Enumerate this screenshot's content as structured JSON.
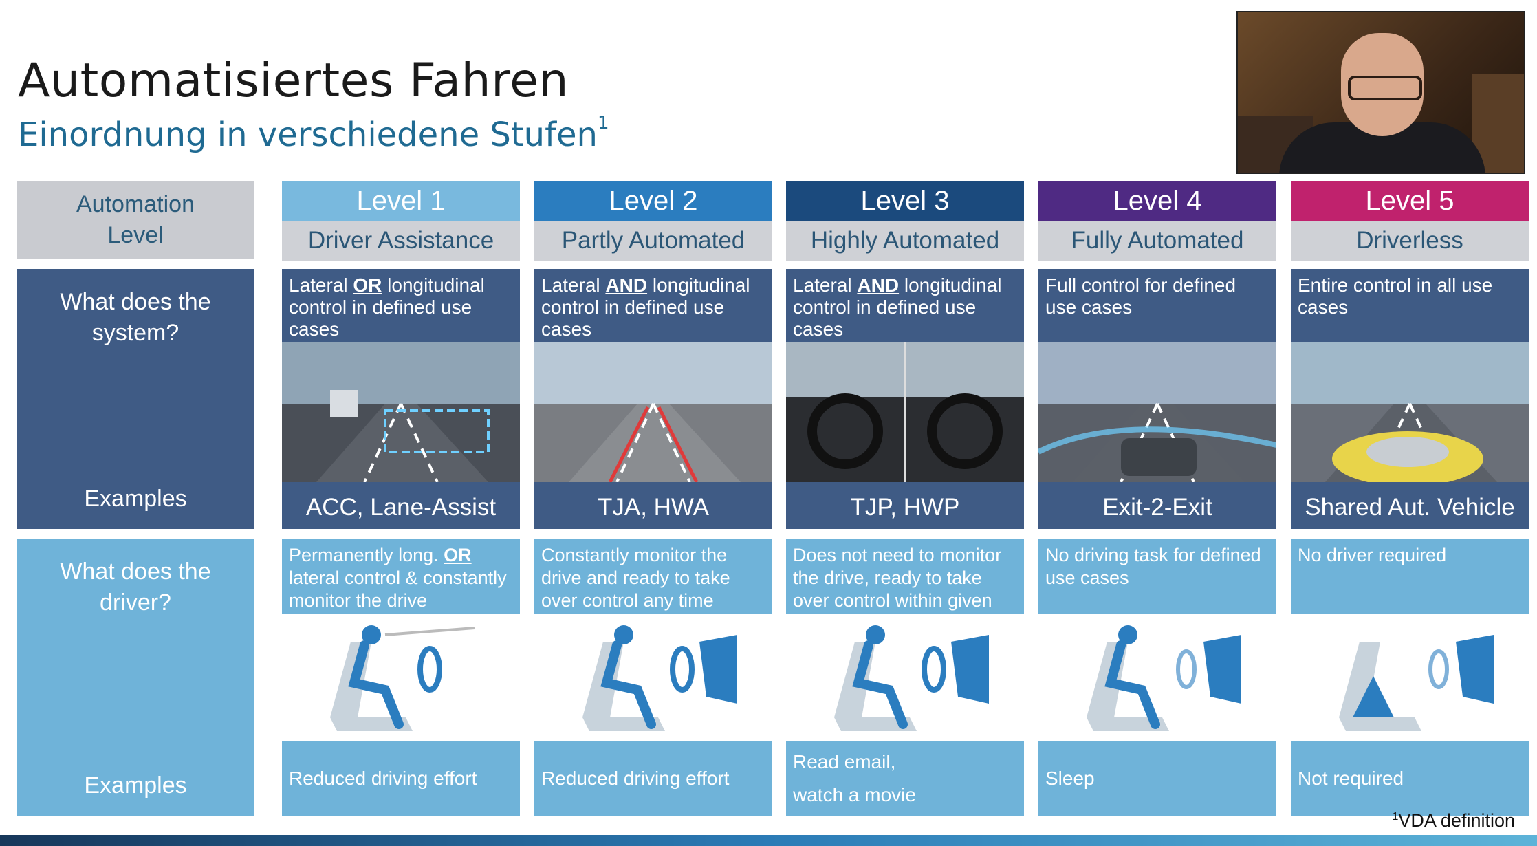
{
  "header": {
    "title": "Automatisiertes Fahren",
    "subtitle": "Einordnung in verschiedene Stufen",
    "subtitle_sup": "1"
  },
  "left": {
    "header": "Automation\nLevel",
    "system_q": "What does the\nsystem?",
    "system_ex": "Examples",
    "driver_q": "What does the\ndriver?",
    "driver_ex": "Examples"
  },
  "levels": [
    {
      "level": "Level 1",
      "name": "Driver Assistance",
      "color": "#79b9de",
      "sys_pre": "Lateral ",
      "sys_bold": "OR",
      "sys_post": " longitudinal control in defined use cases",
      "example": "ACC, Lane-Assist",
      "drv_pre": "Permanently long. ",
      "drv_bold": "OR",
      "drv_post": " lateral control & constantly monitor the drive",
      "drv_example": "Reduced driving effort"
    },
    {
      "level": "Level 2",
      "name": "Partly Automated",
      "color": "#2b7dbf",
      "sys_pre": "Lateral ",
      "sys_bold": "AND",
      "sys_post": " longitudinal control in defined use cases",
      "example": "TJA, HWA",
      "drv_pre": "Constantly monitor the drive and ready to take over control any time",
      "drv_bold": "",
      "drv_post": "",
      "drv_example": "Reduced driving effort"
    },
    {
      "level": "Level 3",
      "name": "Highly Automated",
      "color": "#1b4a7d",
      "sys_pre": "Lateral ",
      "sys_bold": "AND",
      "sys_post": " longitudinal control in defined use cases",
      "example": "TJP, HWP",
      "drv_pre": "Does not need to monitor the drive, ready to take over control  within  given time",
      "drv_bold": "",
      "drv_post": "",
      "drv_example": "Read email,\nwatch a movie"
    },
    {
      "level": "Level 4",
      "name": "Fully Automated",
      "color": "#4f2a83",
      "sys_pre": "Full control for defined use cases",
      "sys_bold": "",
      "sys_post": "",
      "example": "Exit-2-Exit",
      "drv_pre": "No driving task for defined use cases",
      "drv_bold": "",
      "drv_post": "",
      "drv_example": "Sleep"
    },
    {
      "level": "Level 5",
      "name": "Driverless",
      "color": "#c0226d",
      "sys_pre": "Entire control in all use cases",
      "sys_bold": "",
      "sys_post": "",
      "example": "Shared Aut. Vehicle",
      "drv_pre": "No driver required",
      "drv_bold": "",
      "drv_post": "",
      "drv_example": "Not required"
    }
  ],
  "footnote": {
    "sup": "1",
    "text": "VDA definition"
  }
}
